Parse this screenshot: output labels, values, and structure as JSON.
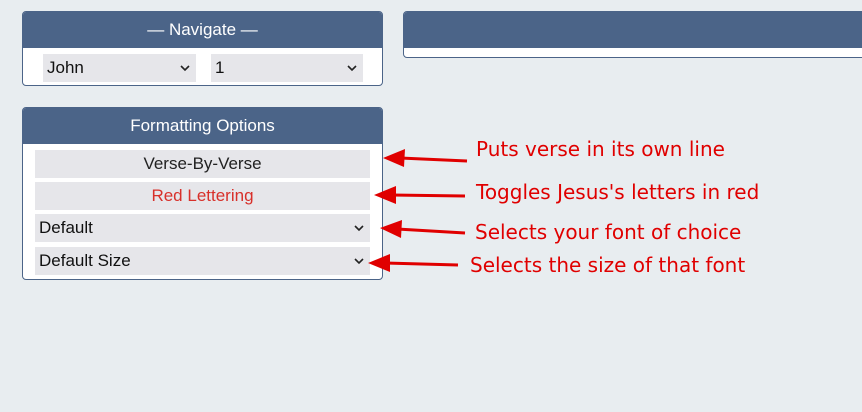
{
  "navigate": {
    "title": "— Navigate —",
    "book": "John",
    "chapter": "1"
  },
  "formatting": {
    "title": "Formatting Options",
    "verse_button": "Verse-By-Verse",
    "red_button": "Red Lettering",
    "font_select": "Default",
    "size_select": "Default Size"
  },
  "annotations": {
    "verse": "Puts verse in its own line",
    "red": "Toggles Jesus's letters in red",
    "font": "Selects your font of choice",
    "size": "Selects the size of that font"
  },
  "colors": {
    "header": "#4b6488",
    "annotation": "#e00000",
    "red_lettering": "#d8302a"
  }
}
